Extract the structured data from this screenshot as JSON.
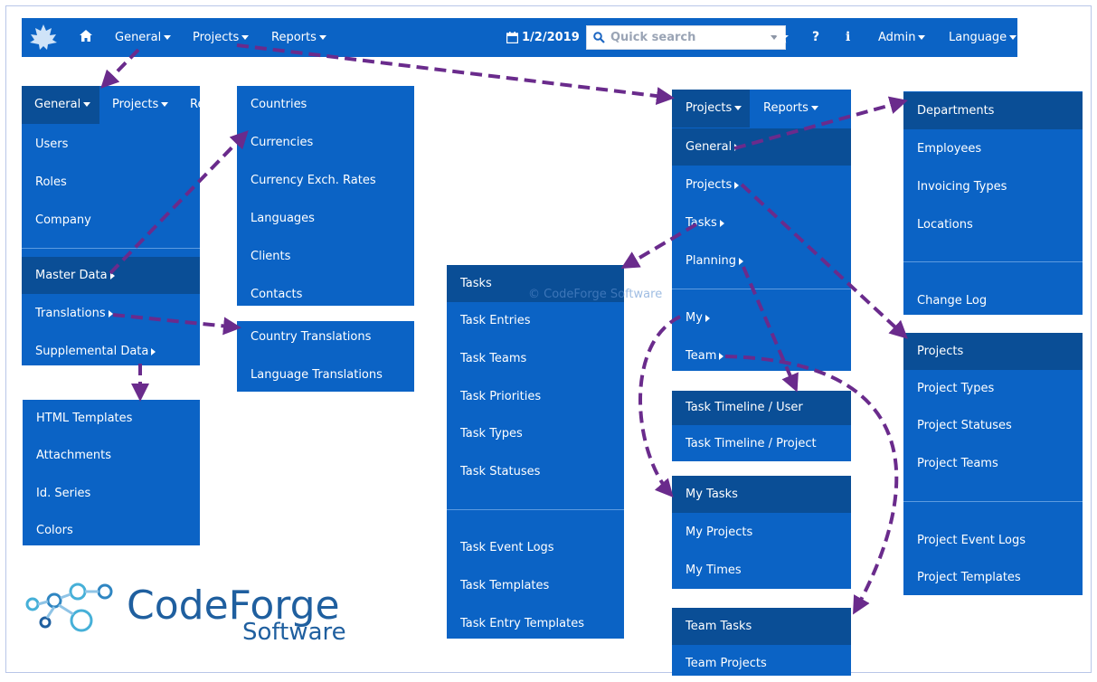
{
  "topbar": {
    "general": "General",
    "projects": "Projects",
    "reports": "Reports",
    "date": "1/2/2019",
    "search_placeholder": "Quick search",
    "admin": "Admin",
    "language": "Language"
  },
  "general_menu": {
    "tabs": [
      "General",
      "Projects",
      "Re"
    ],
    "items": [
      "Users",
      "Roles",
      "Company"
    ],
    "sub_items": [
      "Master Data",
      "Translations",
      "Supplemental Data"
    ]
  },
  "master_data_menu": [
    "Countries",
    "Currencies",
    "Currency Exch. Rates",
    "Languages",
    "Clients",
    "Contacts"
  ],
  "translations_menu": [
    "Country Translations",
    "Language Translations"
  ],
  "supplemental_menu": [
    "HTML Templates",
    "Attachments",
    "Id. Series",
    "Colors"
  ],
  "projects_menu": {
    "tabs": [
      "Projects",
      "Reports"
    ],
    "items": [
      "General",
      "Projects",
      "Tasks",
      "Planning",
      "My",
      "Team"
    ]
  },
  "general_sub_menu": {
    "items": [
      "Departments",
      "Employees",
      "Invoicing Types",
      "Locations"
    ],
    "extra": [
      "Change Log"
    ]
  },
  "projects_sub_menu": {
    "items": [
      "Projects",
      "Project Types",
      "Project Statuses",
      "Project Teams"
    ],
    "extra": [
      "Project Event Logs",
      "Project Templates"
    ]
  },
  "tasks_menu": {
    "items": [
      "Tasks",
      "Task Entries",
      "Task Teams",
      "Task Priorities",
      "Task Types",
      "Task Statuses"
    ],
    "extra": [
      "Task Event Logs",
      "Task Templates",
      "Task Entry Templates"
    ]
  },
  "planning_menu": [
    "Task Timeline / User",
    "Task Timeline / Project"
  ],
  "my_menu": [
    "My Tasks",
    "My Projects",
    "My Times"
  ],
  "team_menu": [
    "Team Tasks",
    "Team Projects"
  ],
  "watermark": "© CodeForge Software",
  "logo": {
    "name": "CodeForge",
    "sub": "Software"
  },
  "colors": {
    "menu": "#0b63c5",
    "menu_highlight": "#0a4e96",
    "arrow": "#6a2b8c",
    "logo": "#1f5f9f"
  }
}
